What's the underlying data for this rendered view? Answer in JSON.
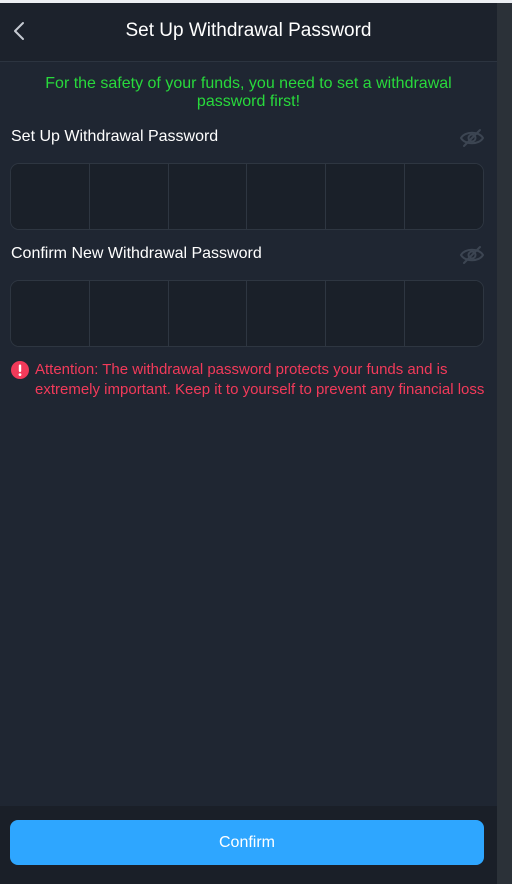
{
  "header": {
    "title": "Set Up Withdrawal Password"
  },
  "notice": "For the safety of your funds, you need to set a withdrawal password first!",
  "set_password": {
    "label": "Set Up Withdrawal Password",
    "digits": [
      "",
      "",
      "",
      "",
      "",
      ""
    ]
  },
  "confirm_password": {
    "label": "Confirm New Withdrawal Password",
    "digits": [
      "",
      "",
      "",
      "",
      "",
      ""
    ]
  },
  "attention": "Attention: The withdrawal password protects your funds and is extremely important. Keep it to yourself to prevent any financial loss",
  "footer": {
    "confirm_label": "Confirm"
  },
  "icons": {
    "back": "chevron-left-icon",
    "visibility": "eye-off-icon",
    "warning": "exclamation-circle-icon"
  },
  "colors": {
    "notice": "#28d93c",
    "attention": "#f23a5a",
    "primary_button": "#2ea6ff",
    "background": "#1f2632"
  }
}
